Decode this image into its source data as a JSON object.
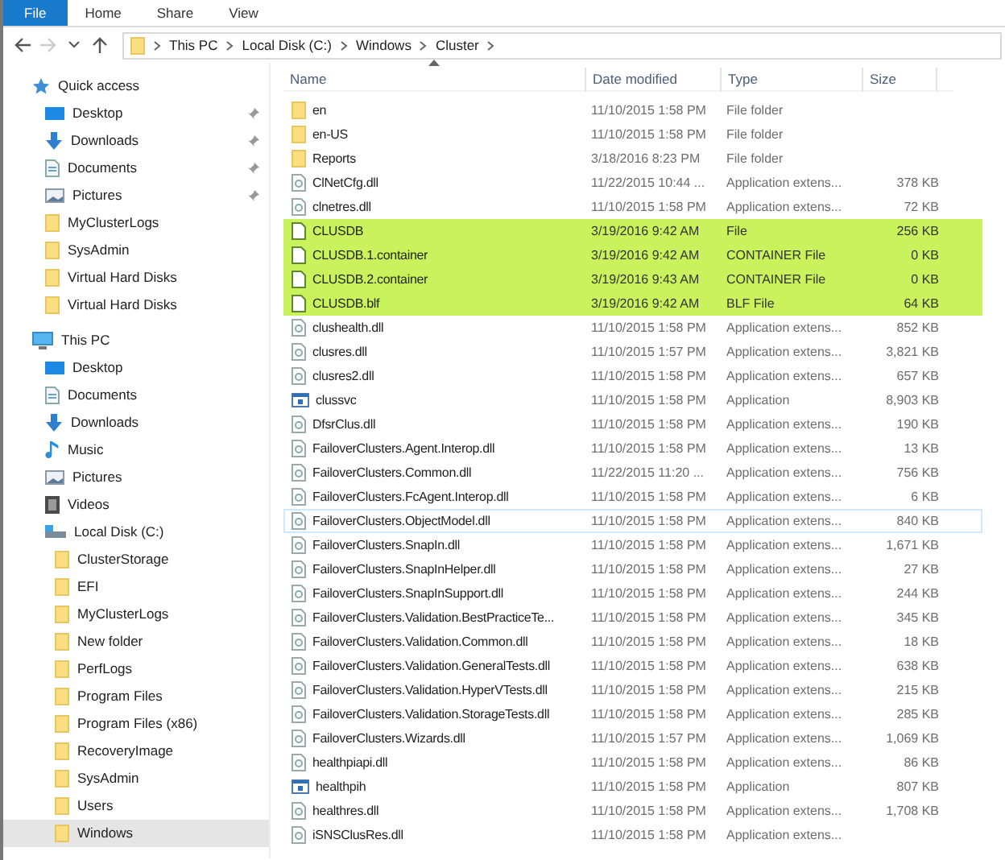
{
  "ribbon_tabs": [
    {
      "label": "File",
      "selected": true
    },
    {
      "label": "Home",
      "selected": false
    },
    {
      "label": "Share",
      "selected": false
    },
    {
      "label": "View",
      "selected": false
    }
  ],
  "address_bar": {
    "breadcrumbs": [
      "This PC",
      "Local Disk (C:)",
      "Windows",
      "Cluster"
    ]
  },
  "sidebar": {
    "items": [
      {
        "label": "Quick access",
        "kind": "star",
        "selected": false,
        "children": [
          {
            "label": "Desktop",
            "kind": "desktop",
            "pinned": true,
            "selected": false
          },
          {
            "label": "Downloads",
            "kind": "download",
            "pinned": true,
            "selected": false
          },
          {
            "label": "Documents",
            "kind": "document",
            "pinned": true,
            "selected": false
          },
          {
            "label": "Pictures",
            "kind": "picture",
            "pinned": true,
            "selected": false
          },
          {
            "label": "MyClusterLogs",
            "kind": "folder",
            "pinned": false,
            "selected": false
          },
          {
            "label": "SysAdmin",
            "kind": "folder",
            "pinned": false,
            "selected": false
          },
          {
            "label": "Virtual Hard Disks",
            "kind": "folder",
            "pinned": false,
            "selected": false
          },
          {
            "label": "Virtual Hard Disks",
            "kind": "folder",
            "pinned": false,
            "selected": false
          }
        ]
      },
      {
        "label": "This PC",
        "kind": "computer",
        "selected": false,
        "children": [
          {
            "label": "Desktop",
            "kind": "desktop",
            "selected": false
          },
          {
            "label": "Documents",
            "kind": "document",
            "selected": false
          },
          {
            "label": "Downloads",
            "kind": "download",
            "selected": false
          },
          {
            "label": "Music",
            "kind": "music",
            "selected": false
          },
          {
            "label": "Pictures",
            "kind": "picture",
            "selected": false
          },
          {
            "label": "Videos",
            "kind": "video",
            "selected": false
          },
          {
            "label": "Local Disk (C:)",
            "kind": "drive",
            "selected": false,
            "children": [
              {
                "label": "ClusterStorage",
                "kind": "folder",
                "selected": false
              },
              {
                "label": "EFI",
                "kind": "folder",
                "selected": false
              },
              {
                "label": "MyClusterLogs",
                "kind": "folder",
                "selected": false
              },
              {
                "label": "New folder",
                "kind": "folder",
                "selected": false
              },
              {
                "label": "PerfLogs",
                "kind": "folder",
                "selected": false
              },
              {
                "label": "Program Files",
                "kind": "folder",
                "selected": false
              },
              {
                "label": "Program Files (x86)",
                "kind": "folder",
                "selected": false
              },
              {
                "label": "RecoveryImage",
                "kind": "folder",
                "selected": false
              },
              {
                "label": "SysAdmin",
                "kind": "folder",
                "selected": false
              },
              {
                "label": "Users",
                "kind": "folder",
                "selected": false
              },
              {
                "label": "Windows",
                "kind": "folder",
                "selected": true
              }
            ]
          }
        ]
      }
    ]
  },
  "file_list": {
    "columns": [
      "Name",
      "Date modified",
      "Type",
      "Size"
    ],
    "rows": [
      {
        "name": "en",
        "date": "11/10/2015 1:58 PM",
        "type": "File folder",
        "kind": "folder",
        "highlighted": false,
        "hovered": false
      },
      {
        "name": "en-US",
        "date": "11/10/2015 1:58 PM",
        "type": "File folder",
        "kind": "folder",
        "highlighted": false,
        "hovered": false
      },
      {
        "name": "Reports",
        "date": "3/18/2016 8:23 PM",
        "type": "File folder",
        "kind": "folder",
        "highlighted": false,
        "hovered": false
      },
      {
        "name": "ClNetCfg.dll",
        "date": "11/22/2015 10:44 ...",
        "type": "Application extens...",
        "size": "378 KB",
        "kind": "dll",
        "highlighted": false,
        "hovered": false
      },
      {
        "name": "clnetres.dll",
        "date": "11/10/2015 1:58 PM",
        "type": "Application extens...",
        "size": "72 KB",
        "kind": "dll",
        "highlighted": false,
        "hovered": false
      },
      {
        "name": "CLUSDB",
        "date": "3/19/2016 9:42 AM",
        "type": "File",
        "size": "256 KB",
        "kind": "file",
        "highlighted": true,
        "hovered": false
      },
      {
        "name": "CLUSDB.1.container",
        "date": "3/19/2016 9:42 AM",
        "type": "CONTAINER File",
        "size": "0 KB",
        "kind": "file",
        "highlighted": true,
        "hovered": false
      },
      {
        "name": "CLUSDB.2.container",
        "date": "3/19/2016 9:43 AM",
        "type": "CONTAINER File",
        "size": "0 KB",
        "kind": "file",
        "highlighted": true,
        "hovered": false
      },
      {
        "name": "CLUSDB.blf",
        "date": "3/19/2016 9:42 AM",
        "type": "BLF File",
        "size": "64 KB",
        "kind": "file",
        "highlighted": true,
        "hovered": false
      },
      {
        "name": "clushealth.dll",
        "date": "11/10/2015 1:58 PM",
        "type": "Application extens...",
        "size": "852 KB",
        "kind": "dll",
        "highlighted": false,
        "hovered": false
      },
      {
        "name": "clusres.dll",
        "date": "11/10/2015 1:57 PM",
        "type": "Application extens...",
        "size": "3,821 KB",
        "kind": "dll",
        "highlighted": false,
        "hovered": false
      },
      {
        "name": "clusres2.dll",
        "date": "11/10/2015 1:58 PM",
        "type": "Application extens...",
        "size": "657 KB",
        "kind": "dll",
        "highlighted": false,
        "hovered": false
      },
      {
        "name": "clussvc",
        "date": "11/10/2015 1:58 PM",
        "type": "Application",
        "size": "8,903 KB",
        "kind": "app",
        "highlighted": false,
        "hovered": false
      },
      {
        "name": "DfsrClus.dll",
        "date": "11/10/2015 1:58 PM",
        "type": "Application extens...",
        "size": "190 KB",
        "kind": "dll",
        "highlighted": false,
        "hovered": false
      },
      {
        "name": "FailoverClusters.Agent.Interop.dll",
        "date": "11/10/2015 1:58 PM",
        "type": "Application extens...",
        "size": "13 KB",
        "kind": "dll",
        "highlighted": false,
        "hovered": false
      },
      {
        "name": "FailoverClusters.Common.dll",
        "date": "11/22/2015 11:20 ...",
        "type": "Application extens...",
        "size": "756 KB",
        "kind": "dll",
        "highlighted": false,
        "hovered": false
      },
      {
        "name": "FailoverClusters.FcAgent.Interop.dll",
        "date": "11/10/2015 1:58 PM",
        "type": "Application extens...",
        "size": "6 KB",
        "kind": "dll",
        "highlighted": false,
        "hovered": false
      },
      {
        "name": "FailoverClusters.ObjectModel.dll",
        "date": "11/10/2015 1:58 PM",
        "type": "Application extens...",
        "size": "840 KB",
        "kind": "dll",
        "highlighted": false,
        "hovered": true
      },
      {
        "name": "FailoverClusters.SnapIn.dll",
        "date": "11/10/2015 1:58 PM",
        "type": "Application extens...",
        "size": "1,671 KB",
        "kind": "dll",
        "highlighted": false,
        "hovered": false
      },
      {
        "name": "FailoverClusters.SnapInHelper.dll",
        "date": "11/10/2015 1:58 PM",
        "type": "Application extens...",
        "size": "27 KB",
        "kind": "dll",
        "highlighted": false,
        "hovered": false
      },
      {
        "name": "FailoverClusters.SnapInSupport.dll",
        "date": "11/10/2015 1:58 PM",
        "type": "Application extens...",
        "size": "244 KB",
        "kind": "dll",
        "highlighted": false,
        "hovered": false
      },
      {
        "name": "FailoverClusters.Validation.BestPracticeTe...",
        "date": "11/10/2015 1:58 PM",
        "type": "Application extens...",
        "size": "345 KB",
        "kind": "dll",
        "highlighted": false,
        "hovered": false
      },
      {
        "name": "FailoverClusters.Validation.Common.dll",
        "date": "11/10/2015 1:58 PM",
        "type": "Application extens...",
        "size": "18 KB",
        "kind": "dll",
        "highlighted": false,
        "hovered": false
      },
      {
        "name": "FailoverClusters.Validation.GeneralTests.dll",
        "date": "11/10/2015 1:58 PM",
        "type": "Application extens...",
        "size": "638 KB",
        "kind": "dll",
        "highlighted": false,
        "hovered": false
      },
      {
        "name": "FailoverClusters.Validation.HyperVTests.dll",
        "date": "11/10/2015 1:58 PM",
        "type": "Application extens...",
        "size": "215 KB",
        "kind": "dll",
        "highlighted": false,
        "hovered": false
      },
      {
        "name": "FailoverClusters.Validation.StorageTests.dll",
        "date": "11/10/2015 1:58 PM",
        "type": "Application extens...",
        "size": "285 KB",
        "kind": "dll",
        "highlighted": false,
        "hovered": false
      },
      {
        "name": "FailoverClusters.Wizards.dll",
        "date": "11/10/2015 1:57 PM",
        "type": "Application extens...",
        "size": "1,069 KB",
        "kind": "dll",
        "highlighted": false,
        "hovered": false
      },
      {
        "name": "healthpiapi.dll",
        "date": "11/10/2015 1:58 PM",
        "type": "Application extens...",
        "size": "86 KB",
        "kind": "dll",
        "highlighted": false,
        "hovered": false
      },
      {
        "name": "healthpih",
        "date": "11/10/2015 1:58 PM",
        "type": "Application",
        "size": "807 KB",
        "kind": "app",
        "highlighted": false,
        "hovered": false
      },
      {
        "name": "healthres.dll",
        "date": "11/10/2015 1:58 PM",
        "type": "Application extens...",
        "size": "1,708 KB",
        "kind": "dll",
        "highlighted": false,
        "hovered": false
      },
      {
        "name": "iSNSClusRes.dll",
        "date": "11/10/2015 1:58 PM",
        "type": "Application extens...",
        "kind": "dll",
        "highlighted": false,
        "hovered": false
      }
    ]
  }
}
